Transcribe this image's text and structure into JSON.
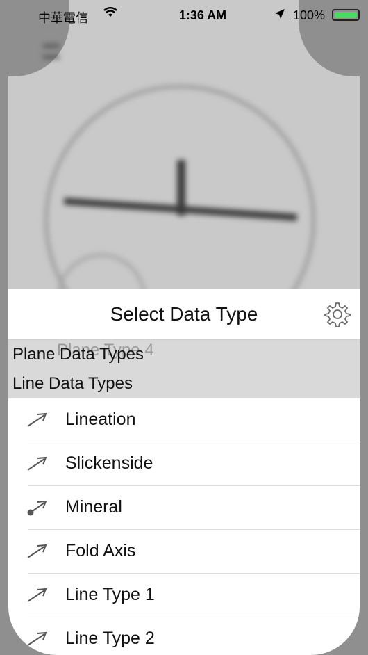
{
  "status_bar": {
    "carrier": "中華電信",
    "time": "1:36 AM",
    "battery": "100%"
  },
  "background": {
    "faded_item": "Plane Type 4"
  },
  "sheet": {
    "title": "Select Data Type",
    "sections": [
      {
        "label": "Plane Data Types"
      },
      {
        "label": "Line Data Types"
      }
    ],
    "items": [
      {
        "label": "Lineation",
        "icon": "arrow-icon"
      },
      {
        "label": "Slickenside",
        "icon": "arrow-icon"
      },
      {
        "label": "Mineral",
        "icon": "dot-arrow-icon"
      },
      {
        "label": "Fold Axis",
        "icon": "arrow-icon"
      },
      {
        "label": "Line Type 1",
        "icon": "arrow-icon"
      },
      {
        "label": "Line Type 2",
        "icon": "arrow-icon"
      }
    ]
  },
  "colors": {
    "section_bg": "#d9d9d9",
    "battery": "#4cd964",
    "icon": "#555555"
  }
}
